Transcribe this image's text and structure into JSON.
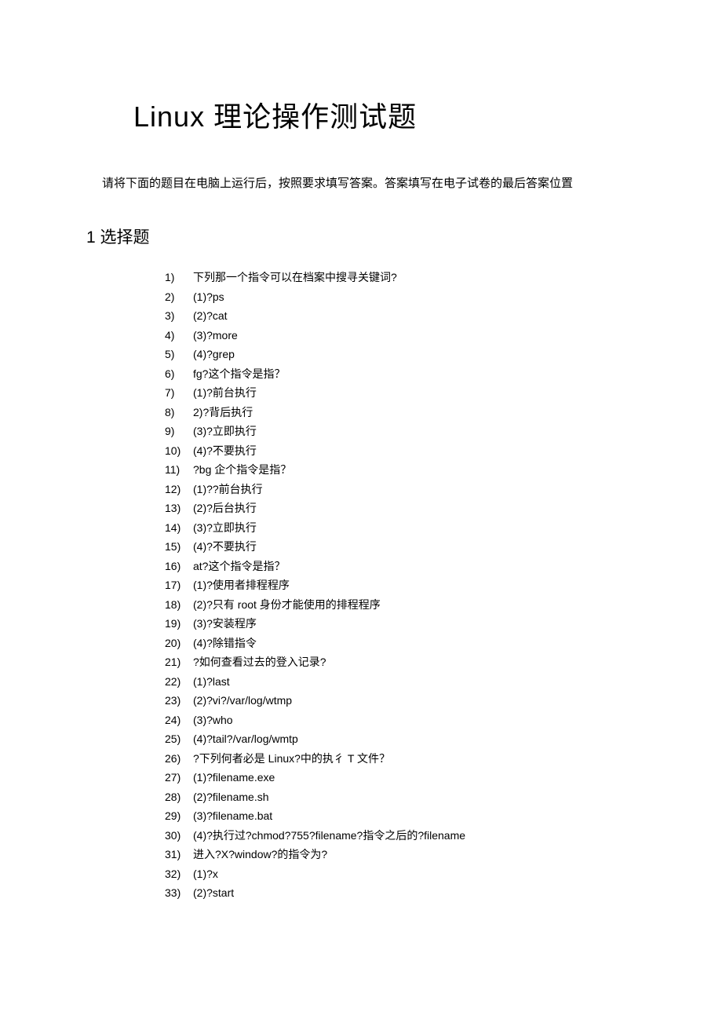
{
  "title": "Linux 理论操作测试题",
  "intro": "请将下面的题目在电脑上运行后，按照要求填写答案。答案填写在电子试卷的最后答案位置",
  "section_heading": "1 选择题",
  "items": [
    "下列那一个指令可以在档案中搜寻关键词?",
    "(1)?ps",
    "(2)?cat",
    "(3)?more",
    "(4)?grep",
    "fg?这个指令是指？",
    "(1)?前台执行",
    "2)?背后执行",
    "(3)?立即执行",
    "(4)?不要执行",
    "?bg 企个指令是指？",
    "(1)??前台执行",
    "(2)?后台执行",
    "(3)?立即执行",
    "(4)?不要执行",
    "at?这个指令是指？",
    "(1)?使用者排程程序",
    "(2)?只有 root 身份才能使用的排程程序",
    "(3)?安装程序",
    "(4)?除错指令",
    "?如何查看过去的登入记录?",
    "(1)?last",
    "(2)?vi?/var/log/wtmp",
    "(3)?who",
    "(4)?tail?/var/log/wmtp",
    "?下列何者必是 Linux?中的执彳 T 文件？",
    "(1)?filename.exe",
    "(2)?filename.sh",
    "(3)?filename.bat",
    "(4)?执行过?chmod?755?filename?指令之后的?filename",
    "进入?X?window?的指令为?",
    "(1)?x",
    "(2)?start"
  ]
}
